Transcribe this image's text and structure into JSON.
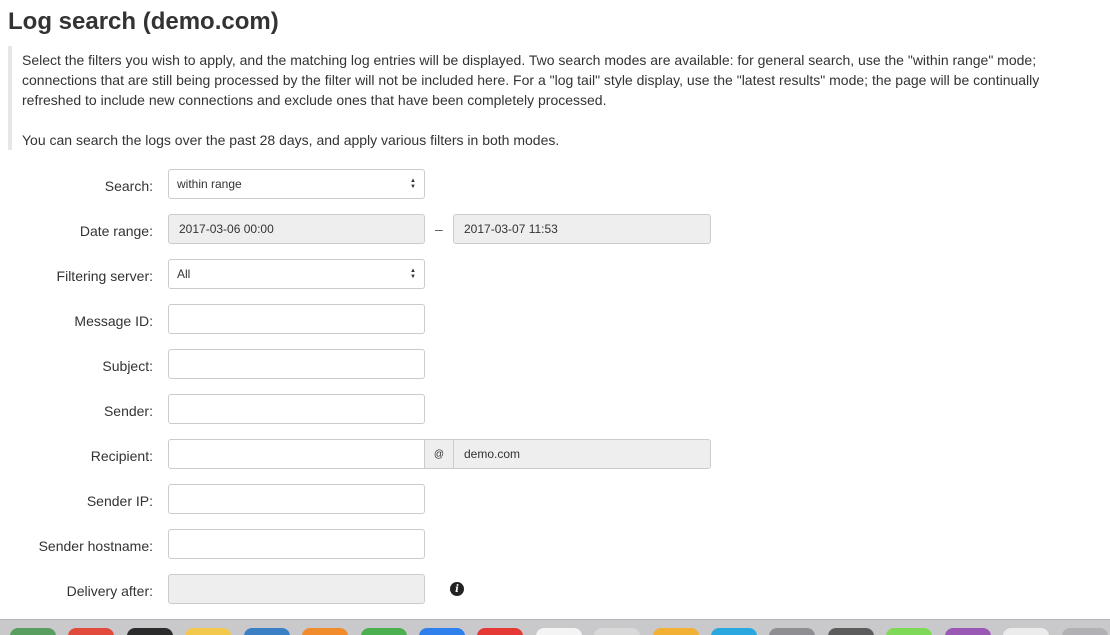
{
  "page": {
    "title": "Log search (demo.com)"
  },
  "intro": {
    "paragraph1": "Select the filters you wish to apply, and the matching log entries will be displayed. Two search modes are available: for general search, use the \"within range\" mode; connections that are still being processed by the filter will not be included here. For a \"log tail\" style display, use the \"latest results\" mode; the page will be continually refreshed to include new connections and exclude ones that have been completely processed.",
    "paragraph2": "You can search the logs over the past 28 days, and apply various filters in both modes."
  },
  "form": {
    "search": {
      "label": "Search:",
      "value": "within range"
    },
    "date_range": {
      "label": "Date range:",
      "from": "2017-03-06 00:00",
      "separator": "–",
      "to": "2017-03-07 11:53"
    },
    "filtering_server": {
      "label": "Filtering server:",
      "value": "All"
    },
    "message_id": {
      "label": "Message ID:",
      "value": ""
    },
    "subject": {
      "label": "Subject:",
      "value": ""
    },
    "sender": {
      "label": "Sender:",
      "value": ""
    },
    "recipient": {
      "label": "Recipient:",
      "value": "",
      "at": "@",
      "domain": "demo.com"
    },
    "sender_ip": {
      "label": "Sender IP:",
      "value": ""
    },
    "sender_hostname": {
      "label": "Sender hostname:",
      "value": ""
    },
    "delivery_after": {
      "label": "Delivery after:",
      "value": "",
      "info_icon": "info-circle-icon"
    }
  },
  "dock": {
    "colors": [
      "#5a9e5f",
      "#e04b3b",
      "#2b2b2b",
      "#f2c94c",
      "#3b7fc4",
      "#f08c2b",
      "#4caf50",
      "#2f80ed",
      "#e53935",
      "#f4f4f4",
      "#d9d9d9",
      "#f2b134",
      "#29a8e0",
      "#8e8e93",
      "#5c5c5c",
      "#7ed957",
      "#9b59b6",
      "#ececec",
      "#b0b0b5"
    ]
  }
}
